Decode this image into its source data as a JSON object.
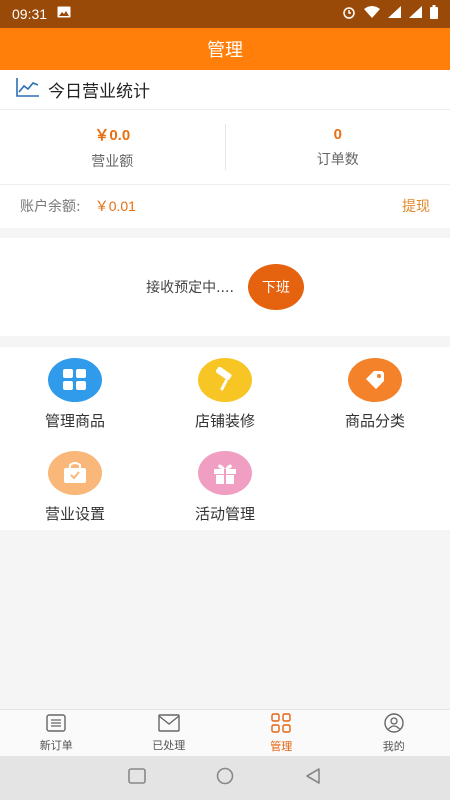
{
  "status_bar": {
    "time": "09:31",
    "icons": [
      "image-icon",
      "alarm-icon",
      "wifi-icon",
      "signal-icon",
      "signal-icon",
      "battery-icon"
    ]
  },
  "header": {
    "title": "管理"
  },
  "stats": {
    "title": "今日营业统计",
    "revenue_value": "￥0.0",
    "revenue_label": "营业额",
    "orders_value": "0",
    "orders_label": "订单数",
    "balance_label": "账户余额:",
    "balance_value": "￥0.01",
    "withdraw_label": "提现"
  },
  "receive": {
    "status_text": "接收预定中....",
    "button_label": "下班"
  },
  "menu": {
    "items": [
      {
        "label": "管理商品",
        "icon": "grid-icon",
        "color": "#2f9bea"
      },
      {
        "label": "店铺装修",
        "icon": "paint-roller-icon",
        "color": "#f7c524"
      },
      {
        "label": "商品分类",
        "icon": "tag-icon",
        "color": "#f4822a"
      },
      {
        "label": "营业设置",
        "icon": "shopping-bag-icon",
        "color": "#f9b77a"
      },
      {
        "label": "活动管理",
        "icon": "gift-icon",
        "color": "#f09ec1"
      }
    ]
  },
  "bottom_nav": {
    "items": [
      {
        "label": "新订单",
        "icon": "list-icon"
      },
      {
        "label": "已处理",
        "icon": "mail-icon"
      },
      {
        "label": "管理",
        "icon": "grid-icon",
        "active": true
      },
      {
        "label": "我的",
        "icon": "user-icon"
      }
    ]
  },
  "colors": {
    "accent": "#ff7f0a",
    "status_bar": "#9a4a08",
    "value_orange": "#e86f10",
    "button": "#e5620f"
  }
}
